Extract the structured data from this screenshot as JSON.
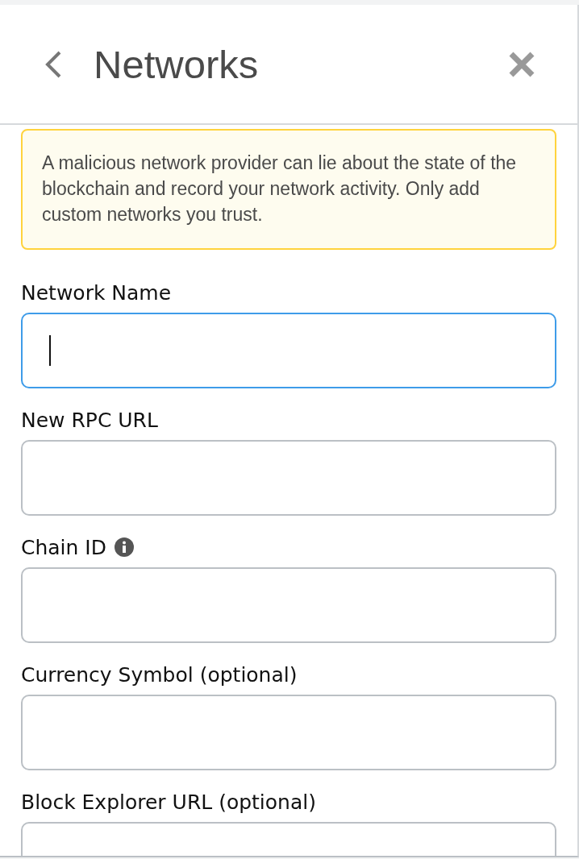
{
  "header": {
    "title": "Networks"
  },
  "warning": {
    "text": "A malicious network provider can lie about the state of the blockchain and record your network activity. Only add custom networks you trust."
  },
  "fields": [
    {
      "label": "Network Name",
      "info": false,
      "focused": true
    },
    {
      "label": "New RPC URL",
      "info": false,
      "focused": false
    },
    {
      "label": "Chain ID",
      "info": true,
      "focused": false
    },
    {
      "label": "Currency Symbol (optional)",
      "info": false,
      "focused": false
    },
    {
      "label": "Block Explorer URL (optional)",
      "info": false,
      "focused": false
    }
  ]
}
